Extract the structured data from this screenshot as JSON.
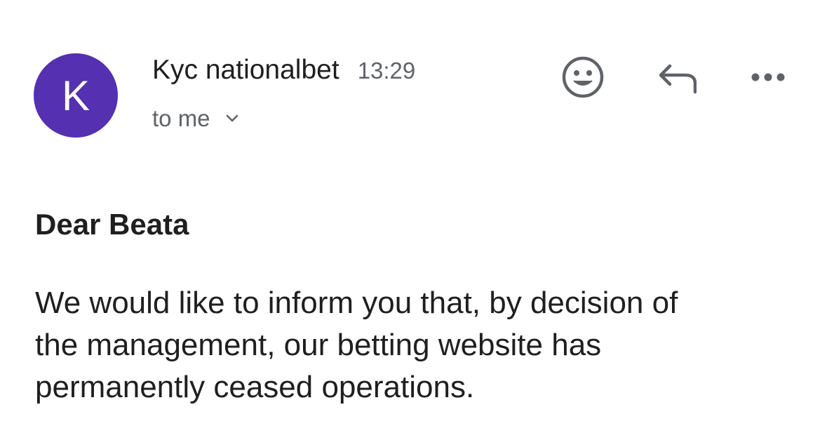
{
  "header": {
    "avatar_initial": "K",
    "avatar_color": "#5530b0",
    "sender_name": "Kyc nationalbet",
    "time": "13:29",
    "recipient_label": "to me",
    "recipient_toggle_icon": "chevron-down-icon"
  },
  "actions": {
    "emoji_icon": "smiley-face-icon",
    "reply_icon": "reply-arrow-icon",
    "more_icon": "more-horizontal-icon"
  },
  "message": {
    "greeting": "Dear Beata",
    "body_lines": [
      "We would like to inform you that, by decision of",
      "the management, our betting website has",
      "permanently ceased operations."
    ]
  },
  "colors": {
    "text_primary": "#1f1f1f",
    "text_secondary": "#5f6368",
    "icon": "#5f6368"
  }
}
